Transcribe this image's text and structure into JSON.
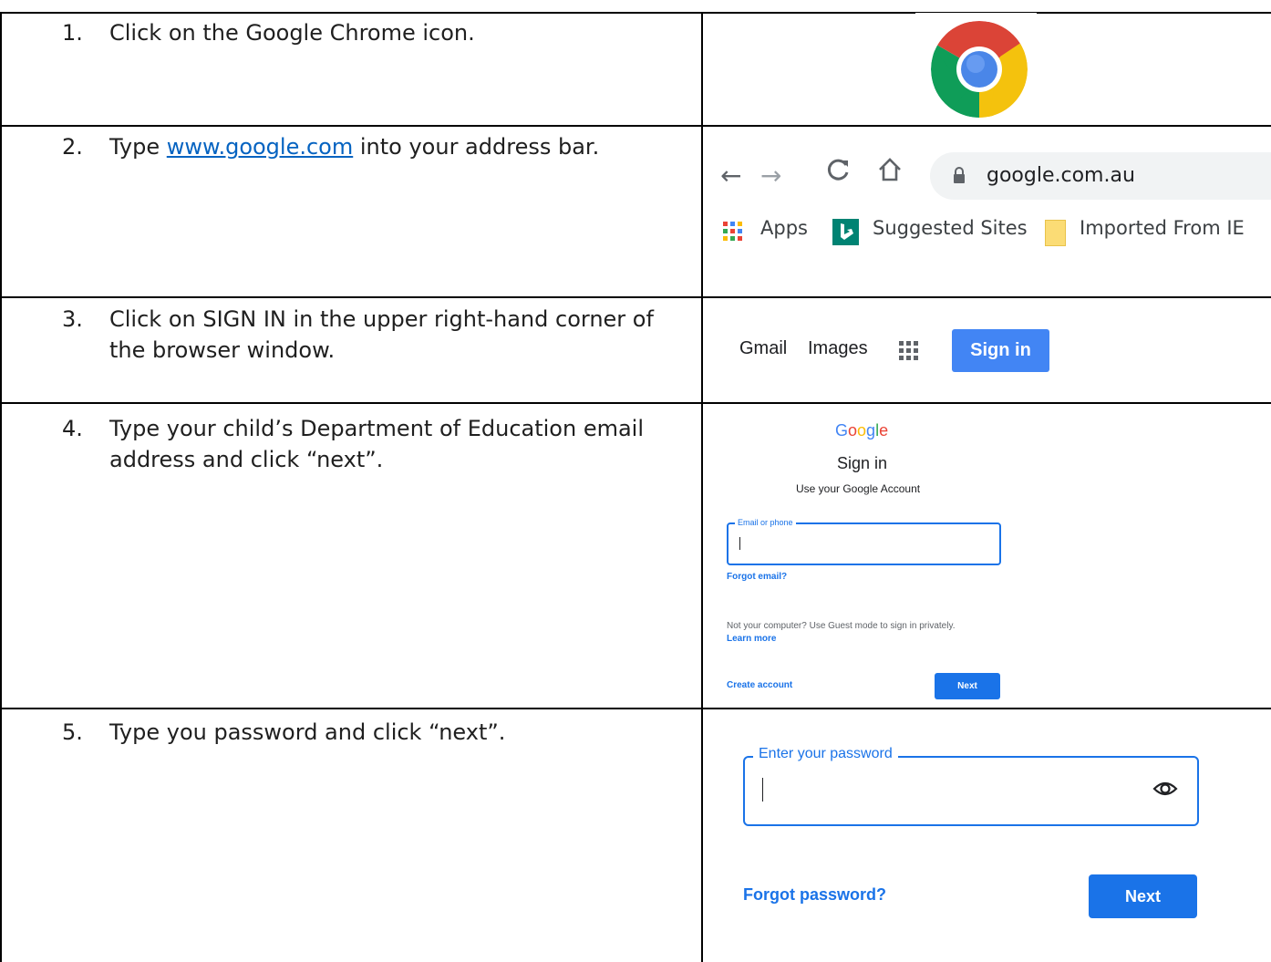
{
  "steps": [
    {
      "num": "1.",
      "text": "Click on the Google Chrome icon."
    },
    {
      "num": "2.",
      "text_before": "Type ",
      "link": "www.google.com",
      "text_after": " into your address bar."
    },
    {
      "num": "3.",
      "text": "Click on SIGN IN in the upper right-hand corner of the browser window."
    },
    {
      "num": "4.",
      "text": "Type your child’s Department of Education email address and click “next”."
    },
    {
      "num": "5.",
      "text": "Type you password and click “next”."
    }
  ],
  "browser": {
    "address": "google.com.au",
    "bookmarks": {
      "apps": "Apps",
      "suggested": "Suggested Sites",
      "imported": "Imported From IE"
    }
  },
  "google_header": {
    "gmail": "Gmail",
    "images": "Images",
    "sign_in": "Sign in"
  },
  "signin_form": {
    "logo": "Google",
    "title": "Sign in",
    "subtitle": "Use your Google Account",
    "email_label": "Email or phone",
    "forgot_email": "Forgot email?",
    "guest_text": "Not your computer? Use Guest mode to sign in privately.",
    "learn_more": "Learn more",
    "create_account": "Create account",
    "next": "Next"
  },
  "password_form": {
    "label": "Enter your password",
    "forgot_password": "Forgot password?",
    "next": "Next"
  },
  "colors": {
    "google_blue": "#1a73e8",
    "signin_blue": "#4285f4",
    "link_blue": "#0563c1"
  }
}
